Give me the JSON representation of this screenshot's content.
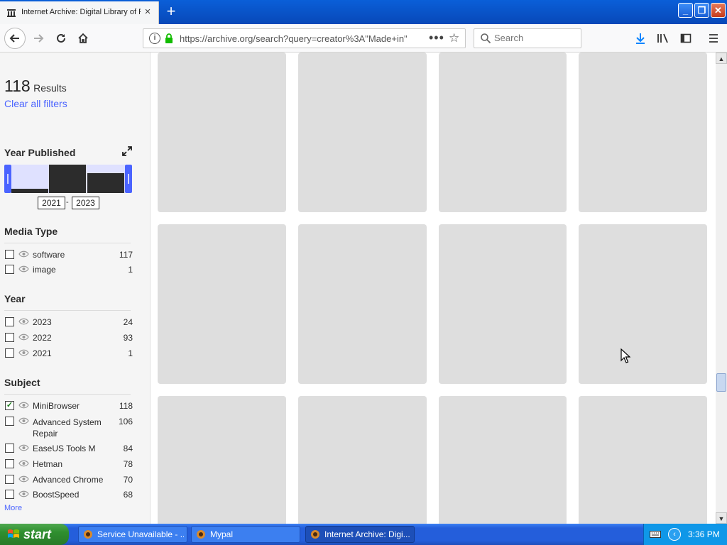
{
  "browser": {
    "tab_title": "Internet Archive: Digital Library of Free & Borrowable Books, Movies, Music & Wayback Machine",
    "tab_close": "×",
    "new_tab": "+",
    "url": "https://archive.org/search?query=creator%3A\"Made+in\"",
    "search_placeholder": "Search"
  },
  "sidebar": {
    "results_count": "118",
    "results_label": "Results",
    "clear_filters": "Clear all filters",
    "year_published": {
      "title": "Year Published",
      "from": "2021",
      "to": "2023",
      "dash": "-"
    },
    "media_type": {
      "title": "Media Type",
      "items": [
        {
          "label": "software",
          "count": "117",
          "checked": false
        },
        {
          "label": "image",
          "count": "1",
          "checked": false
        }
      ]
    },
    "year": {
      "title": "Year",
      "items": [
        {
          "label": "2023",
          "count": "24",
          "checked": false
        },
        {
          "label": "2022",
          "count": "93",
          "checked": false
        },
        {
          "label": "2021",
          "count": "1",
          "checked": false
        }
      ]
    },
    "subject": {
      "title": "Subject",
      "items": [
        {
          "label": "MiniBrowser",
          "count": "118",
          "checked": true
        },
        {
          "label": "Advanced System Repair",
          "count": "106",
          "checked": false
        },
        {
          "label": "EaseUS Tools M",
          "count": "84",
          "checked": false
        },
        {
          "label": "Hetman",
          "count": "78",
          "checked": false
        },
        {
          "label": "Advanced Chrome",
          "count": "70",
          "checked": false
        },
        {
          "label": "BoostSpeed",
          "count": "68",
          "checked": false
        }
      ],
      "more": "More"
    }
  },
  "taskbar": {
    "start": "start",
    "items": [
      {
        "label": "Service Unavailable - ...",
        "active": false
      },
      {
        "label": "Mypal",
        "active": false
      },
      {
        "label": "Internet Archive: Digi...",
        "active": true
      }
    ],
    "clock": "3:36 PM"
  },
  "colors": {
    "accent": "#4b64ff",
    "tile": "#dedede",
    "histogram_bar": "#2c2c2c",
    "xp_blue": "#245edb",
    "start_green": "#2f8f2f"
  }
}
